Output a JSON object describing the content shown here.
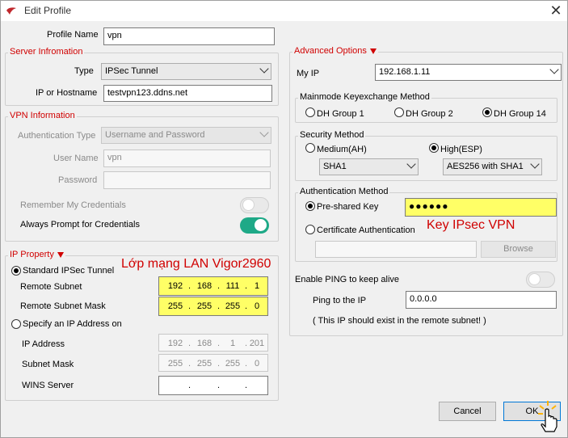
{
  "window": {
    "title": "Edit Profile",
    "close_glyph": "✕"
  },
  "profile": {
    "label": "Profile Name",
    "value": "vpn"
  },
  "server_info": {
    "legend": "Server Infromation",
    "type_label": "Type",
    "type_value": "IPSec Tunnel",
    "host_label": "IP or Hostname",
    "host_value": "testvpn123.ddns.net"
  },
  "vpn_info": {
    "legend": "VPN Information",
    "auth_type_label": "Authentication Type",
    "auth_type_value": "Username and Password",
    "user_label": "User Name",
    "user_value": "vpn",
    "password_label": "Password",
    "password_value": "",
    "remember_label": "Remember My Credentials",
    "remember_on": false,
    "prompt_label": "Always Prompt for Credentials",
    "prompt_on": true
  },
  "ip_property": {
    "legend": "IP Property",
    "standard_label": "Standard IPSec Tunnel",
    "annotation": "Lớp mạng LAN Vigor2960",
    "remote_subnet_label": "Remote Subnet",
    "remote_subnet": [
      "192",
      "168",
      "111",
      "1"
    ],
    "remote_mask_label": "Remote Subnet Mask",
    "remote_mask": [
      "255",
      "255",
      "255",
      "0"
    ],
    "specify_label": "Specify an IP Address on",
    "ip_address_label": "IP Address",
    "ip_address": [
      "192",
      "168",
      "1",
      "201"
    ],
    "subnet_mask_label": "Subnet Mask",
    "subnet_mask": [
      "255",
      "255",
      "255",
      "0"
    ],
    "wins_label": "WINS Server",
    "wins": [
      "",
      "",
      "",
      ""
    ]
  },
  "advanced": {
    "legend": "Advanced Options",
    "my_ip_label": "My IP",
    "my_ip_value": "192.168.1.11",
    "mainmode": {
      "legend": "Mainmode Keyexchange Method",
      "options": [
        "DH Group 1",
        "DH Group 2",
        "DH Group 14"
      ],
      "selected": "DH Group 14"
    },
    "security": {
      "legend": "Security Method",
      "medium_label": "Medium(AH)",
      "high_label": "High(ESP)",
      "selected": "High(ESP)",
      "medium_combo": "SHA1",
      "high_combo": "AES256 with SHA1"
    },
    "auth": {
      "legend": "Authentication Method",
      "psk_label": "Pre-shared Key",
      "psk_value": "●●●●●●",
      "annotation": "Key IPsec VPN",
      "cert_label": "Certificate Authentication",
      "cert_value": "",
      "browse_label": "Browse"
    },
    "ping_label": "Enable PING to keep alive",
    "ping_on": false,
    "ping_ip_label": "Ping to the IP",
    "ping_ip_value": "0.0.0.0",
    "ping_note": "( This IP should exist in the remote subnet! )"
  },
  "buttons": {
    "cancel": "Cancel",
    "ok": "OK"
  },
  "colors": {
    "accent_red": "#d00000",
    "toggle_on": "#1ea987",
    "highlight": "#ffff66"
  }
}
